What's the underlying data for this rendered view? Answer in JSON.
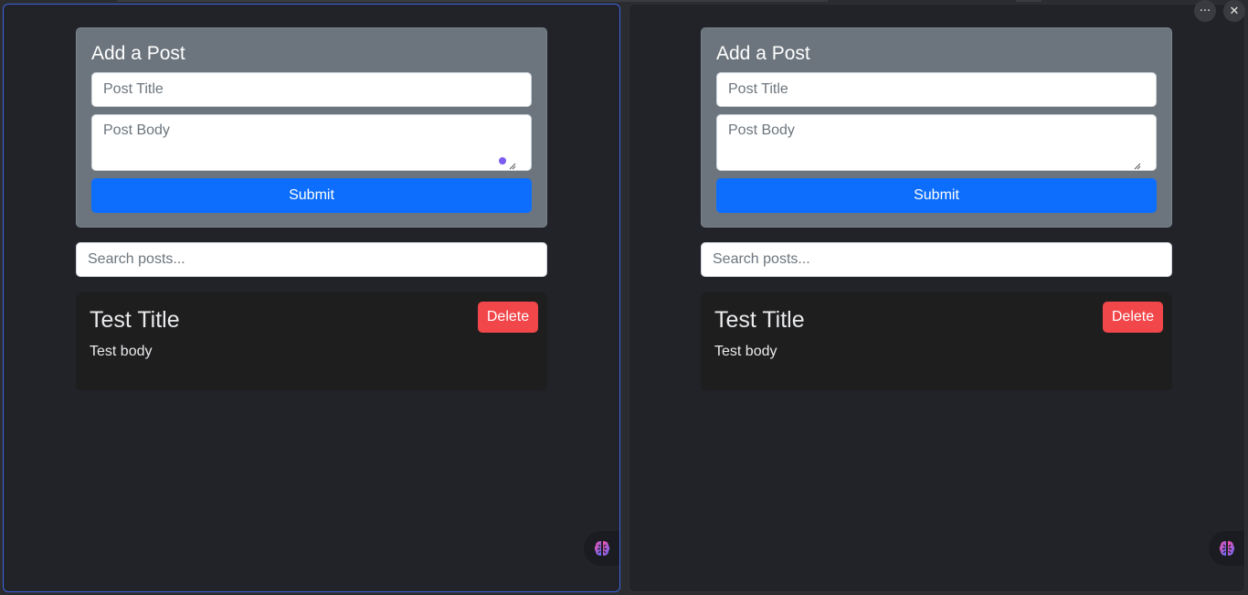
{
  "window": {
    "more_icon": "more-horizontal-icon",
    "more_label": "···",
    "close_label": "✕"
  },
  "panes": [
    {
      "form": {
        "title": "Add a Post",
        "title_placeholder": "Post Title",
        "body_placeholder": "Post Body",
        "submit_label": "Submit"
      },
      "search": {
        "placeholder": "Search posts..."
      },
      "post": {
        "title": "Test Title",
        "body": "Test body",
        "delete_label": "Delete"
      }
    },
    {
      "form": {
        "title": "Add a Post",
        "title_placeholder": "Post Title",
        "body_placeholder": "Post Body",
        "submit_label": "Submit"
      },
      "search": {
        "placeholder": "Search posts..."
      },
      "post": {
        "title": "Test Title",
        "body": "Test body",
        "delete_label": "Delete"
      }
    }
  ],
  "colors": {
    "page_bg": "#212329",
    "form_bg": "#6c747d",
    "submit": "#0d6efd",
    "delete": "#f1474b",
    "post_bg": "#1e1e1f",
    "focus_border": "#3b63e0"
  }
}
